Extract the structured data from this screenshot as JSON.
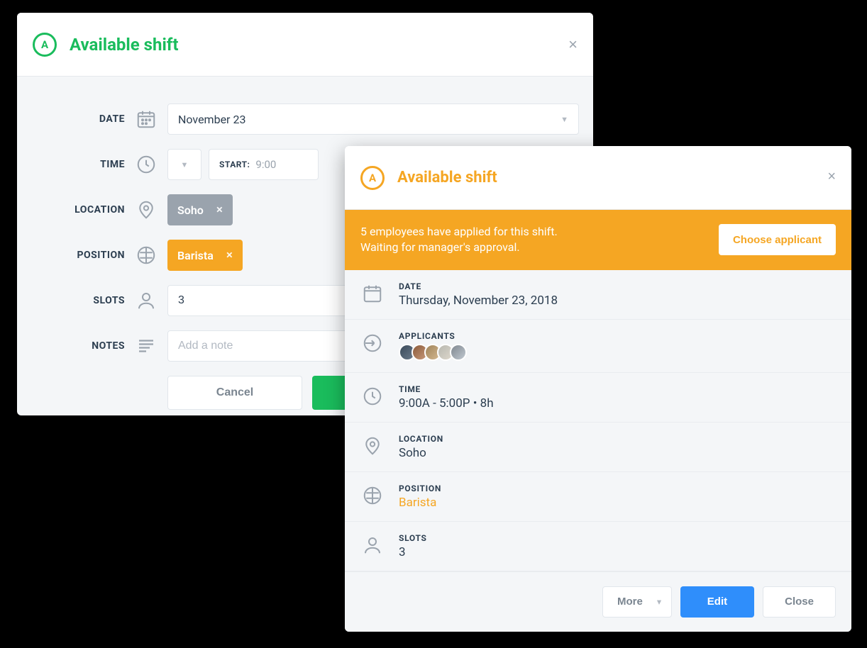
{
  "panel1": {
    "title": "Available shift",
    "date": {
      "label": "DATE",
      "value": "November 23"
    },
    "time": {
      "label": "TIME",
      "start_label": "START:",
      "start_value": "9:00"
    },
    "location": {
      "label": "LOCATION",
      "chip": "Soho"
    },
    "position": {
      "label": "POSITION",
      "chip": "Barista"
    },
    "slots": {
      "label": "SLOTS",
      "value": "3"
    },
    "notes": {
      "label": "NOTES",
      "placeholder": "Add a note"
    },
    "cancel": "Cancel"
  },
  "panel2": {
    "title": "Available shift",
    "banner": {
      "line1": "5 employees have applied for this shift.",
      "line2": "Waiting for manager's approval.",
      "button": "Choose applicant"
    },
    "date": {
      "label": "DATE",
      "value": "Thursday, November 23, 2018"
    },
    "applicants": {
      "label": "APPLICANTS",
      "count": 5
    },
    "time": {
      "label": "TIME",
      "value": "9:00A - 5:00P • 8h"
    },
    "location": {
      "label": "LOCATION",
      "value": "Soho"
    },
    "position": {
      "label": "POSITION",
      "value": "Barista"
    },
    "slots": {
      "label": "SLOTS",
      "value": "3"
    },
    "actions": {
      "more": "More",
      "edit": "Edit",
      "close": "Close"
    }
  }
}
